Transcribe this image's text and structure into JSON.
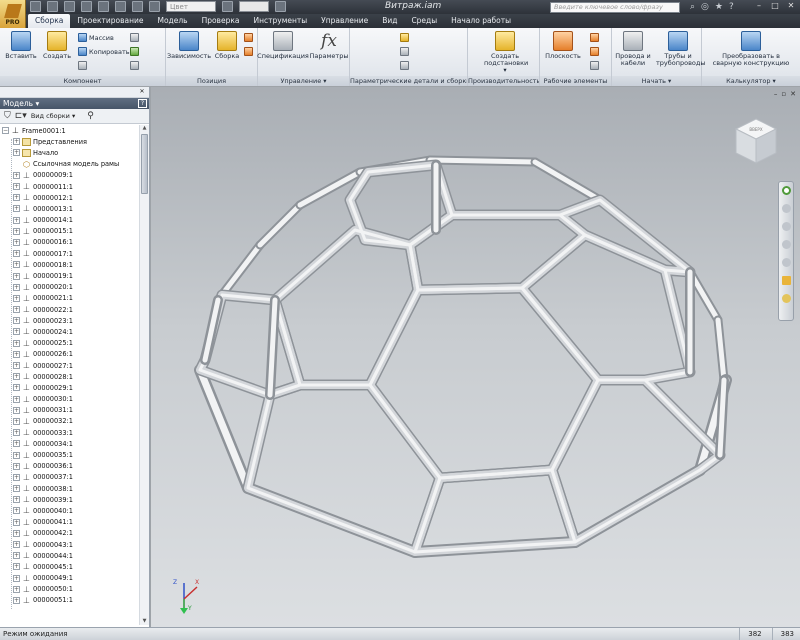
{
  "app": {
    "badge": "PRO",
    "title": "Витраж.iam",
    "search_placeholder": "Введите ключевое слово/фразу",
    "color_select": "Цвет"
  },
  "tabs": [
    "Сборка",
    "Проектирование",
    "Модель",
    "Проверка",
    "Инструменты",
    "Управление",
    "Вид",
    "Среды",
    "Начало работы"
  ],
  "active_tab": "Сборка",
  "ribbon": {
    "component": {
      "label": "Компонент",
      "insert": "Вставить",
      "create": "Создать",
      "pattern": "Массив",
      "copy": "Копировать"
    },
    "position": {
      "label": "Позиция",
      "constrain": "Зависимость",
      "assemble": "Сборка"
    },
    "manage": {
      "label": "Управление ▾",
      "bom": "Спецификация",
      "params": "Параметры"
    },
    "params_parts": {
      "label": "Параметрические детали и сборки"
    },
    "productivity": {
      "label": "Производительность",
      "substitute": "Создать подстановки ▾"
    },
    "work_features": {
      "label": "Рабочие элементы",
      "plane": "Плоскость"
    },
    "begin": {
      "label": "Начать ▾",
      "cables": "Провода и кабели",
      "tubes": "Трубы и трубопроводы"
    },
    "calculator": {
      "label": "Калькулятор ▾",
      "weldment": "Преобразовать в сварную конструкцию"
    }
  },
  "browser": {
    "title": "Модель ▾",
    "assembly_view": "Вид сборки",
    "root": "Frame0001:1",
    "fixed_items": [
      "Представления",
      "Начало",
      "Ссылочная модель рамы"
    ],
    "parts": [
      "00000009:1",
      "00000011:1",
      "00000012:1",
      "00000013:1",
      "00000014:1",
      "00000015:1",
      "00000016:1",
      "00000017:1",
      "00000018:1",
      "00000019:1",
      "00000020:1",
      "00000021:1",
      "00000022:1",
      "00000023:1",
      "00000024:1",
      "00000025:1",
      "00000026:1",
      "00000027:1",
      "00000028:1",
      "00000029:1",
      "00000030:1",
      "00000031:1",
      "00000032:1",
      "00000033:1",
      "00000034:1",
      "00000035:1",
      "00000036:1",
      "00000037:1",
      "00000038:1",
      "00000039:1",
      "00000040:1",
      "00000041:1",
      "00000042:1",
      "00000043:1",
      "00000044:1",
      "00000045:1",
      "00000049:1",
      "00000050:1",
      "00000051:1"
    ]
  },
  "viewcube": {
    "face": "ВВЕРХ"
  },
  "triad": {
    "x": "X",
    "y": "Y",
    "z": "Z"
  },
  "status": {
    "text": "Режим ожидания",
    "count1": "382",
    "count2": "383"
  }
}
